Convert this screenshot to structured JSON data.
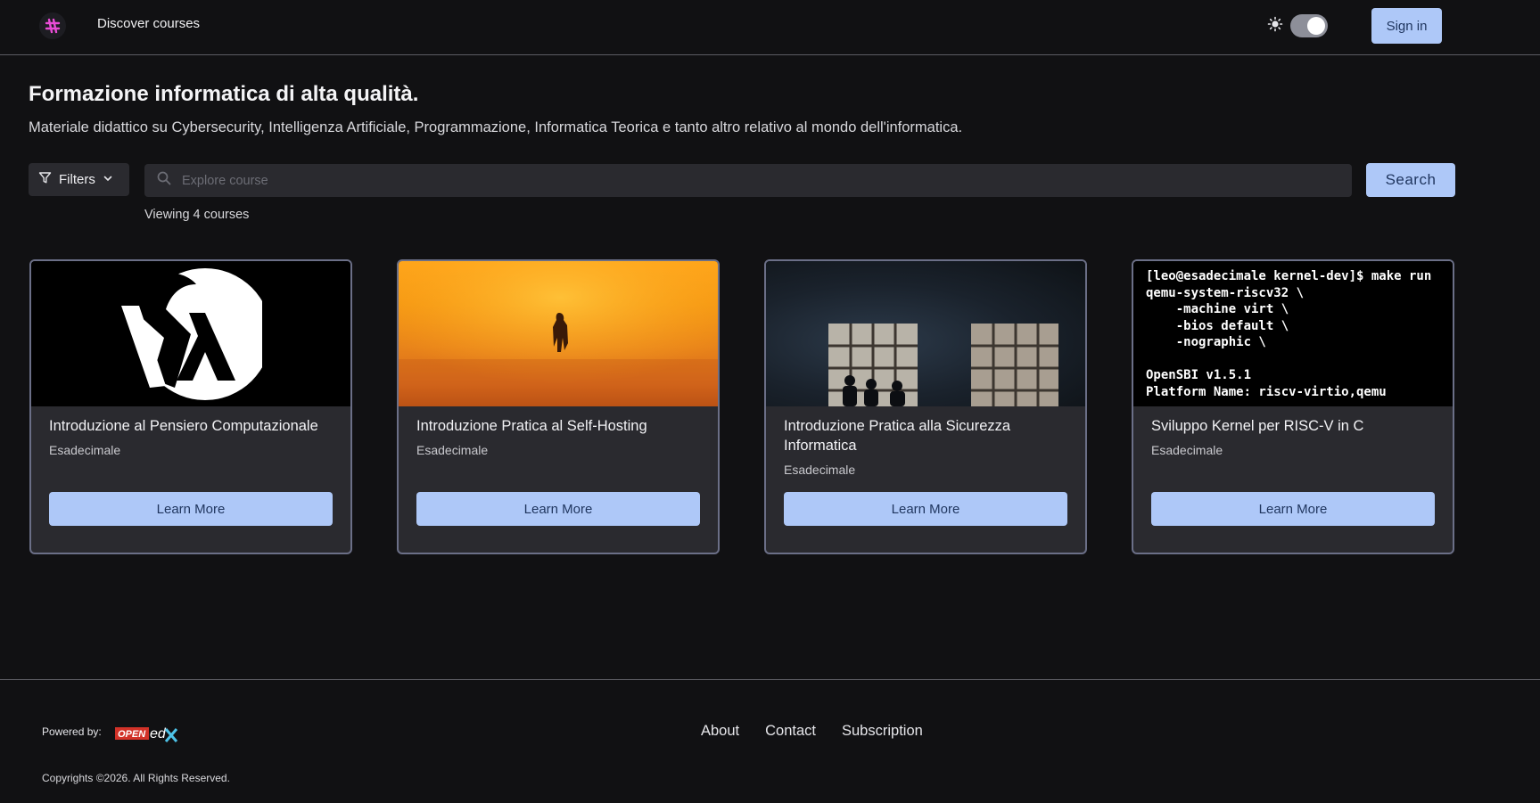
{
  "header": {
    "nav_discover": "Discover courses",
    "sign_in": "Sign in",
    "theme": "dark"
  },
  "hero": {
    "title": "Formazione informatica di alta qualità.",
    "subtitle": "Materiale didattico su Cybersecurity, Intelligenza Artificiale, Programmazione, Informatica Teorica e tanto altro relativo al mondo dell'informatica."
  },
  "search": {
    "filters_label": "Filters",
    "placeholder": "Explore course",
    "value": "",
    "button_label": "Search",
    "viewing_text": "Viewing 4 courses"
  },
  "courses": [
    {
      "title": "Introduzione al Pensiero Computazionale",
      "org": "Esadecimale",
      "cta": "Learn More"
    },
    {
      "title": "Introduzione Pratica al Self-Hosting",
      "org": "Esadecimale",
      "cta": "Learn More"
    },
    {
      "title": "Introduzione Pratica alla Sicurezza Informatica",
      "org": "Esadecimale",
      "cta": "Learn More"
    },
    {
      "title": "Sviluppo Kernel per RISC-V in C",
      "org": "Esadecimale",
      "cta": "Learn More",
      "terminal_lines": "[leo@esadecimale kernel-dev]$ make run\nqemu-system-riscv32 \\\n    -machine virt \\\n    -bios default \\\n    -nographic \\\n\nOpenSBI v1.5.1\nPlatform Name: riscv-virtio,qemu"
    }
  ],
  "footer": {
    "powered_by": "Powered by:",
    "links": [
      "About",
      "Contact",
      "Subscription"
    ],
    "copyright": "Copyrights ©2026. All Rights Reserved."
  },
  "colors": {
    "background": "#111113",
    "accent": "#aec8f8",
    "accent_text": "#1f355e",
    "card_bg": "#2a2a2f",
    "card_border": "#6b6f87"
  }
}
